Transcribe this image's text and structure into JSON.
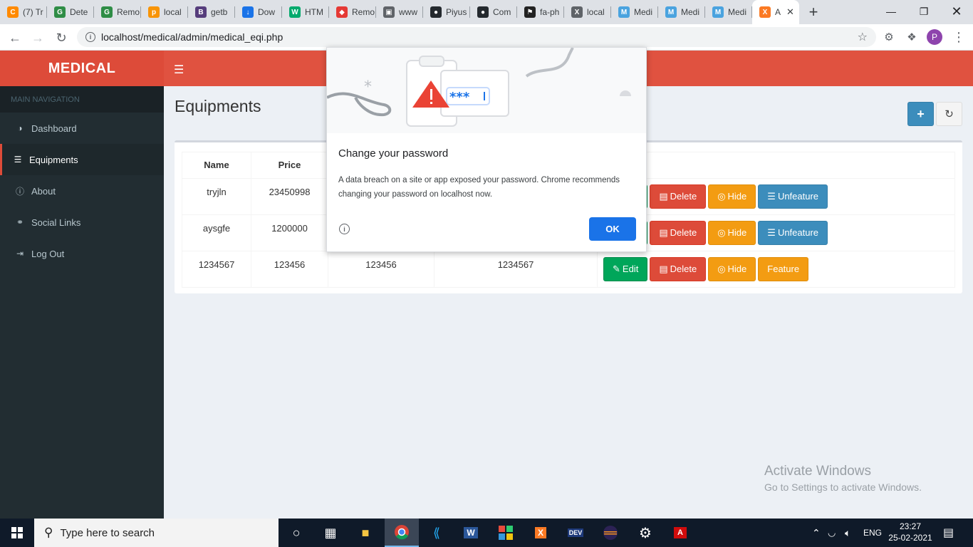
{
  "browser": {
    "tabs": [
      {
        "label": "(7) Tr",
        "icon": "c-icon",
        "color": "#ff8a00"
      },
      {
        "label": "Dete",
        "icon": "geeks-icon",
        "color": "#2f8d46"
      },
      {
        "label": "Remo",
        "icon": "geeks-icon",
        "color": "#2f8d46"
      },
      {
        "label": "local",
        "icon": "phpmyadmin-icon",
        "color": "#f89406"
      },
      {
        "label": "getb",
        "icon": "bootstrap-icon",
        "color": "#563d7c"
      },
      {
        "label": "Dow",
        "icon": "download-icon",
        "color": "#1a73e8"
      },
      {
        "label": "HTM",
        "icon": "w3-icon",
        "color": "#04aa6d"
      },
      {
        "label": "Remo",
        "icon": "diamond-icon",
        "color": "#e53935"
      },
      {
        "label": "www",
        "icon": "lock-icon",
        "color": "#5f6368"
      },
      {
        "label": "Piyus",
        "icon": "github-icon",
        "color": "#24292e"
      },
      {
        "label": "Com",
        "icon": "github-icon",
        "color": "#24292e"
      },
      {
        "label": "fa-ph",
        "icon": "fontawesome-icon",
        "color": "#222222"
      },
      {
        "label": "local",
        "icon": "xampp-icon",
        "color": "#5f6368"
      },
      {
        "label": "Medi",
        "icon": "medical-icon",
        "color": "#4aa3df"
      },
      {
        "label": "Medi",
        "icon": "medical-icon",
        "color": "#4aa3df"
      },
      {
        "label": "Medi",
        "icon": "medical-icon",
        "color": "#4aa3df"
      },
      {
        "label": "A",
        "icon": "xampp-icon",
        "color": "#fb7a24",
        "active": true
      }
    ],
    "url": "localhost/medical/admin/medical_eqi.php",
    "profile_initial": "P"
  },
  "app": {
    "brand": "MEDICAL",
    "nav_header": "MAIN NAVIGATION",
    "nav_items": [
      {
        "label": "Dashboard",
        "icon": "dashboard-icon"
      },
      {
        "label": "Equipments",
        "icon": "list-icon",
        "active": true
      },
      {
        "label": "About",
        "icon": "info-icon"
      },
      {
        "label": "Social Links",
        "icon": "link-icon"
      },
      {
        "label": "Log Out",
        "icon": "logout-icon"
      }
    ],
    "page_title": "Equipments",
    "table": {
      "columns": [
        "Name",
        "Price"
      ],
      "rows": [
        {
          "name": "tryjln",
          "price": "23450998",
          "c3": "",
          "c4": "",
          "feature_label": "Unfeature"
        },
        {
          "name": "aysgfe",
          "price": "1200000",
          "c3": "",
          "c4": "",
          "feature_label": "Unfeature"
        },
        {
          "name": "1234567",
          "price": "123456",
          "c3": "123456",
          "c4": "1234567",
          "feature_label": "Feature"
        }
      ],
      "edit_label": "Edit",
      "delete_label": "Delete",
      "hide_label": "Hide"
    }
  },
  "dialog": {
    "title": "Change your password",
    "body": "A data breach on a site or app exposed your password. Chrome recommends changing your password on localhost now.",
    "ok_label": "OK",
    "illus_text": "***"
  },
  "watermark": {
    "line1": "Activate Windows",
    "line2": "Go to Settings to activate Windows."
  },
  "taskbar": {
    "search_placeholder": "Type here to search",
    "language": "ENG",
    "time": "23:27",
    "date": "25-02-2021"
  },
  "colors": {
    "brand_red": "#dd4b39",
    "sidebar_bg": "#222d32",
    "success": "#00a65a",
    "warning": "#f39c12",
    "primary": "#3c8dbc"
  }
}
